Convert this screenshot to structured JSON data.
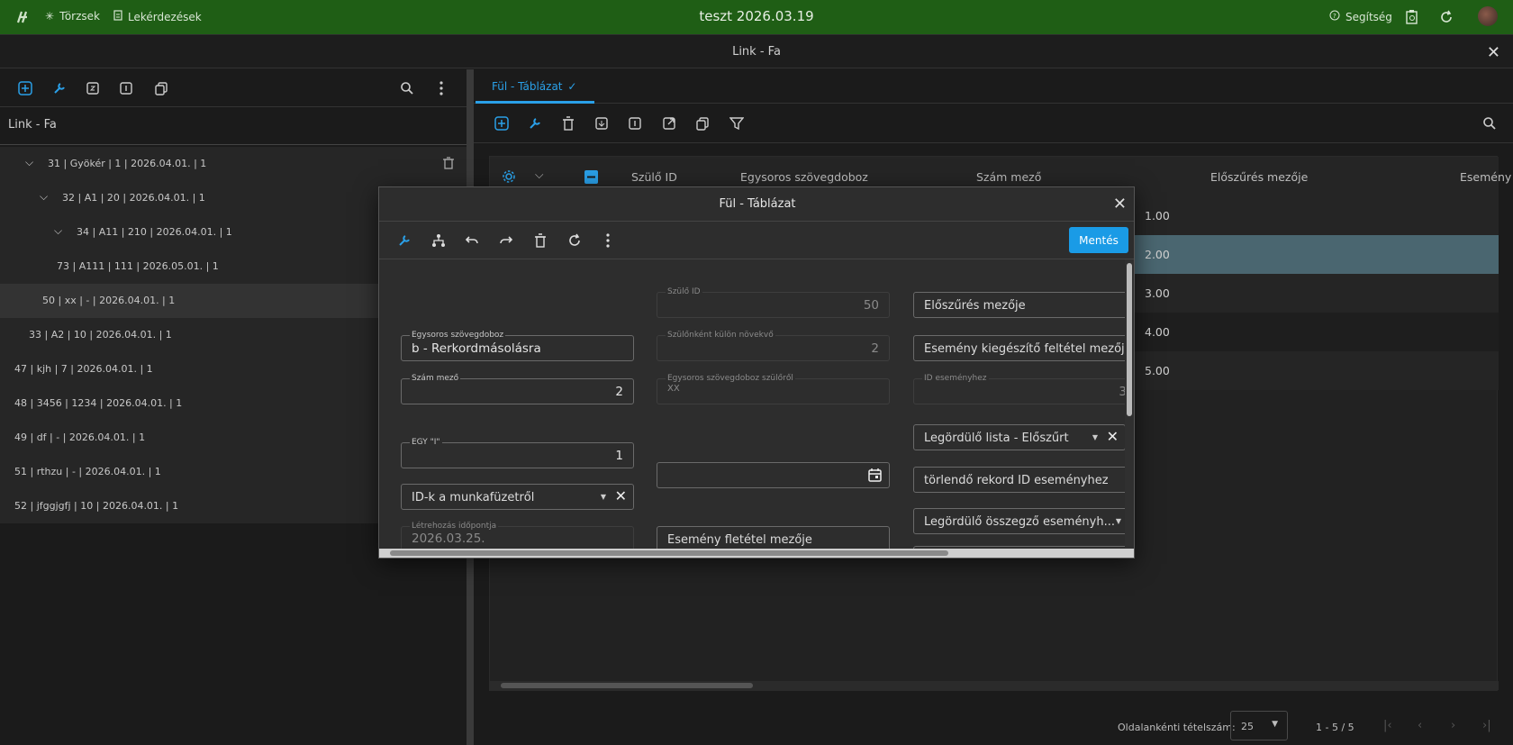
{
  "app": {
    "title": "teszt 2026.03.19",
    "nav": [
      {
        "label": "Törzsek",
        "icon": "asterisk-icon"
      },
      {
        "label": "Lekérdezések",
        "icon": "document-icon"
      }
    ],
    "help_label": "Segítség"
  },
  "window": {
    "title": "Link - Fa"
  },
  "left": {
    "title": "Link - Fa",
    "tree": [
      {
        "label": "31 | Gyökér | 1 | 2026.04.01. | 1"
      },
      {
        "label": "32 | A1 | 20 | 2026.04.01. | 1"
      },
      {
        "label": "34 | A11 | 210 | 2026.04.01. | 1"
      },
      {
        "label": "73 | A111 | 111 | 2026.05.01. | 1"
      },
      {
        "label": "50 | xx | - | 2026.04.01. | 1"
      },
      {
        "label": "33 | A2 | 10 | 2026.04.01. | 1"
      },
      {
        "label": "47 | kjh | 7 | 2026.04.01. | 1"
      },
      {
        "label": "48 | 3456 | 1234 | 2026.04.01. | 1"
      },
      {
        "label": "49 | df | - | 2026.04.01. | 1"
      },
      {
        "label": "51 | rthzu | - | 2026.04.01. | 1"
      },
      {
        "label": "52 | jfggjgfj | 10 | 2026.04.01. | 1"
      }
    ]
  },
  "right": {
    "tab_label": "Fül - Táblázat",
    "columns": [
      "Szülő ID",
      "Egysoros szövegdoboz",
      "Szám mező",
      "Előszűrés mezője",
      "Esemény"
    ],
    "rows": [
      "1.00",
      "2.00",
      "3.00",
      "4.00",
      "5.00"
    ],
    "pager": {
      "label": "Oldalankénti tételszám:",
      "size": "25",
      "range": "1 - 5 / 5"
    }
  },
  "dialog": {
    "title": "Fül - Táblázat",
    "save_label": "Mentés",
    "fields": {
      "szulo_id": {
        "label": "Szülő ID",
        "value": "50"
      },
      "egysoros": {
        "label": "Egysoros szövegdoboz",
        "value": "b - Rerkordmásolásra"
      },
      "szulonkent": {
        "label": "Szülőnként külön növekvő",
        "value": "2"
      },
      "szam": {
        "label": "Szám mező",
        "value": "2"
      },
      "egysoros_szulo": {
        "label": "Egysoros szövegdoboz szülőről",
        "value": "XX"
      },
      "egy": {
        "label": "EGY \"I\"",
        "value": "1"
      },
      "ids": {
        "value": "ID-k a munkafüzetről"
      },
      "letrehozas": {
        "label": "Létrehozás időpontja",
        "value": "2026.03.25."
      },
      "esemeny_fletetel": {
        "value": "Esemény fletétel mezője"
      },
      "eloszures": {
        "value": "Előszűrés mezője"
      },
      "esemeny_kieg": {
        "value": "Esemény kiegészítő feltétel mezője"
      },
      "id_esemenyhez": {
        "label": "ID eseményhez",
        "value": "3"
      },
      "legordulo_eloszurt": {
        "value": "Legördülő lista - Előszűrt"
      },
      "torlendo": {
        "value": "törlendő rekord ID eseményhez"
      },
      "legordulo_osszegzo": {
        "value": "Legördülő összegző eseményh..."
      }
    }
  }
}
